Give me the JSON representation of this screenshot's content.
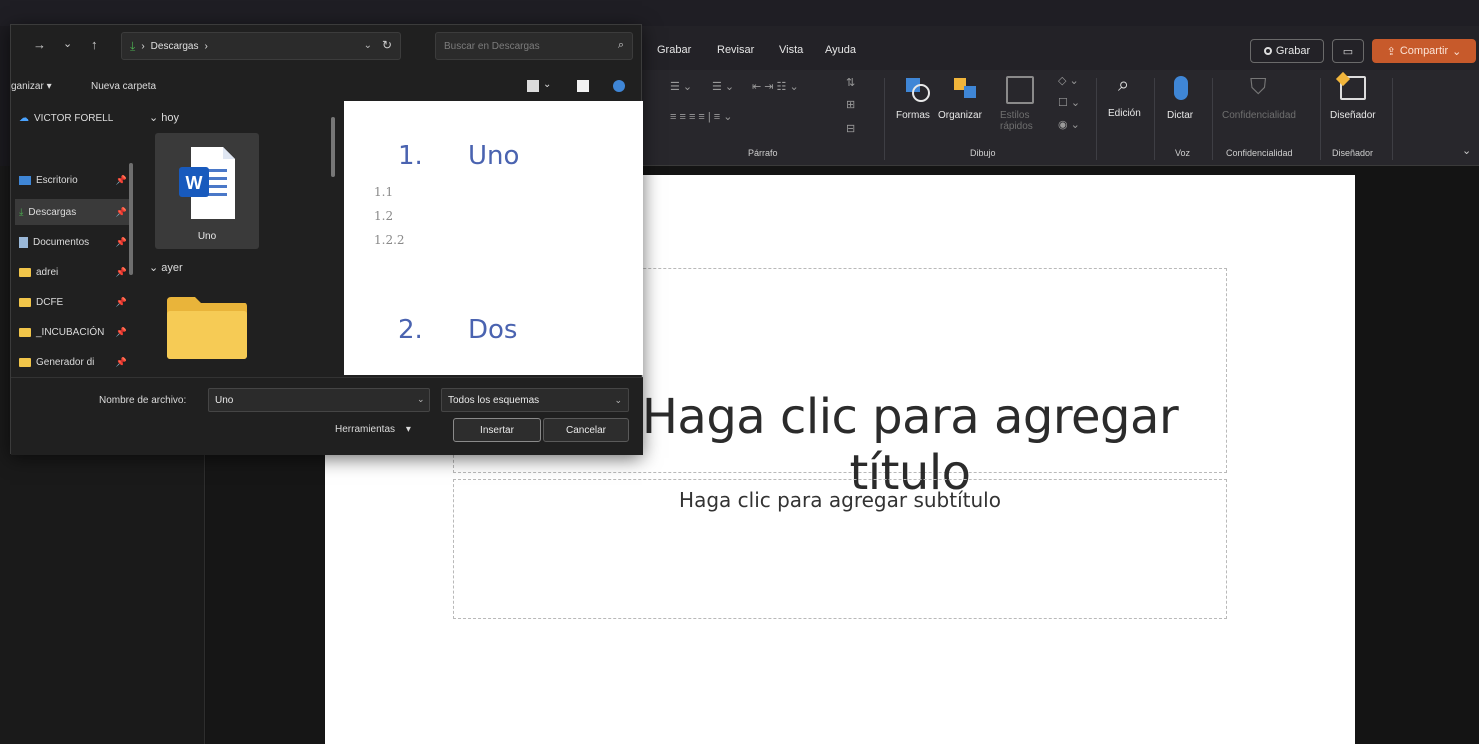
{
  "ppt": {
    "menu_tabs": [
      "Grabar",
      "Revisar",
      "Vista",
      "Ayuda"
    ],
    "record_button": "Grabar",
    "share_button": "Compartir",
    "ribbon": {
      "groups": [
        "Párrafo",
        "Dibujo",
        "Voz",
        "Confidencialidad",
        "Diseñador"
      ],
      "shapes_label": "Formas",
      "arrange_label": "Organizar",
      "quick_styles_label": "Estilos rápidos",
      "edit_label": "Edición",
      "dictate_label": "Dictar",
      "confidentiality_label": "Confidencialidad",
      "designer_label": "Diseñador"
    },
    "slide": {
      "title_placeholder": "Haga clic para agregar título",
      "subtitle_placeholder": "Haga clic para agregar subtítulo"
    }
  },
  "dialog": {
    "address": {
      "path": "Descargas",
      "separator": "›"
    },
    "search_placeholder": "Buscar en Descargas",
    "toolbar": {
      "organize": "ganizar",
      "new_folder": "Nueva carpeta"
    },
    "sidebar": {
      "items": [
        {
          "label": "VICTOR FORELL",
          "icon": "cloud-icon"
        },
        {
          "label": "Escritorio",
          "icon": "desktop-icon"
        },
        {
          "label": "Descargas",
          "icon": "download-icon"
        },
        {
          "label": "Documentos",
          "icon": "documents-icon"
        },
        {
          "label": "adrei",
          "icon": "folder-icon"
        },
        {
          "label": "DCFE",
          "icon": "folder-icon"
        },
        {
          "label": "_INCUBACIÓN",
          "icon": "folder-icon"
        },
        {
          "label": "Generador di",
          "icon": "folder-icon"
        }
      ]
    },
    "files": {
      "group_today": "hoy",
      "group_yesterday": "ayer",
      "file_name": "Uno"
    },
    "preview": {
      "heading1_num": "1.",
      "heading1": "Uno",
      "sub1": "1.1",
      "sub2": "1.2",
      "sub3": "1.2.2",
      "heading2_num": "2.",
      "heading2": "Dos"
    },
    "filename_label": "Nombre de archivo:",
    "filename_value": "Uno",
    "filter": "Todos los esquemas",
    "tools": "Herramientas",
    "insert": "Insertar",
    "cancel": "Cancelar"
  },
  "colors": {
    "share": "#c75a2b",
    "preview_heading": "#4a63b0",
    "word_blue": "#185abd"
  }
}
